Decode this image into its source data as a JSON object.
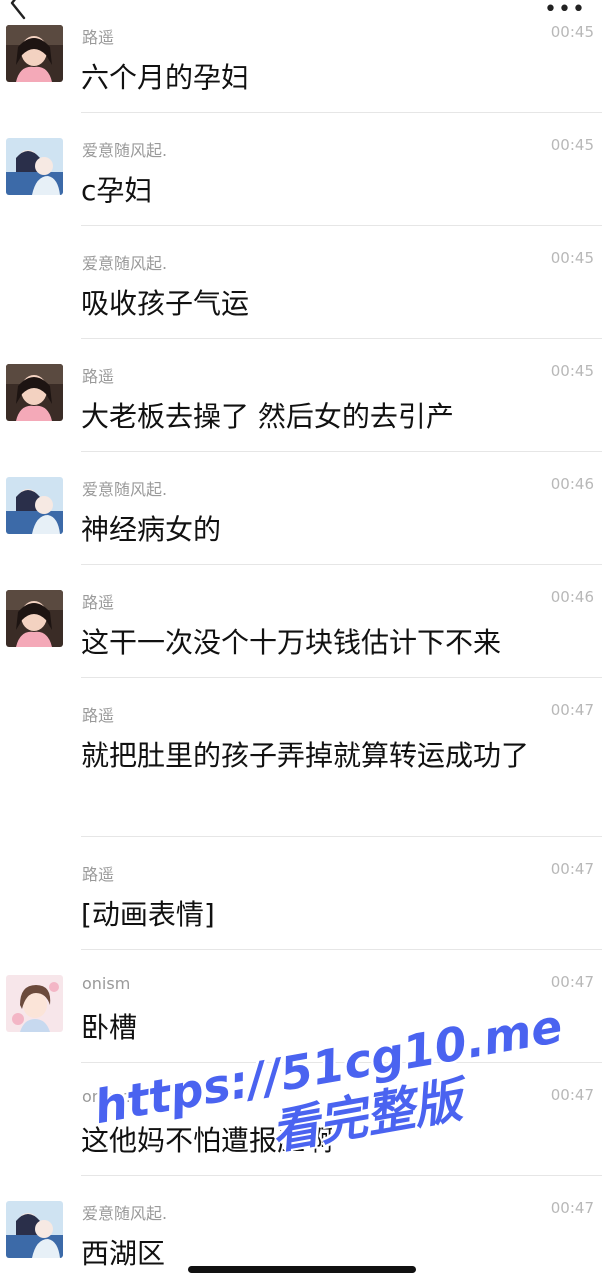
{
  "top_bar": {
    "back_icon": "chevron-left-icon",
    "more_label": "•••"
  },
  "messages": [
    {
      "sender": "路遥",
      "time": "00:45",
      "text": "六个月的孕妇",
      "avatar": "luyao"
    },
    {
      "sender": "爱意随风起.",
      "time": "00:45",
      "text": "c孕妇",
      "avatar": "aiyi"
    },
    {
      "sender": "爱意随风起.",
      "time": "00:45",
      "text": "吸收孩子气运",
      "avatar": ""
    },
    {
      "sender": "路遥",
      "time": "00:45",
      "text": "大老板去操了 然后女的去引产",
      "avatar": "luyao"
    },
    {
      "sender": "爱意随风起.",
      "time": "00:46",
      "text": "神经病女的",
      "avatar": "aiyi"
    },
    {
      "sender": "路遥",
      "time": "00:46",
      "text": "这干一次没个十万块钱估计下不来",
      "avatar": "luyao"
    },
    {
      "sender": "路遥",
      "time": "00:47",
      "text": "就把肚里的孩子弄掉就算转运成功了",
      "avatar": ""
    },
    {
      "sender": "路遥",
      "time": "00:47",
      "text": "[动画表情]",
      "avatar": ""
    },
    {
      "sender": "onism",
      "time": "00:47",
      "text": "卧槽",
      "avatar": "onism"
    },
    {
      "sender": "onism",
      "time": "00:47",
      "text": "这他妈不怕遭报应啊",
      "avatar": ""
    },
    {
      "sender": "爱意随风起.",
      "time": "00:47",
      "text": "西湖区",
      "avatar": "aiyi"
    }
  ],
  "watermark": {
    "url": "https://51cg10.me",
    "sub": "看完整版"
  },
  "colors": {
    "sender": "#9a9a9a",
    "time": "#b8b8b8",
    "text": "#111111",
    "watermark": "#4a63f0"
  }
}
